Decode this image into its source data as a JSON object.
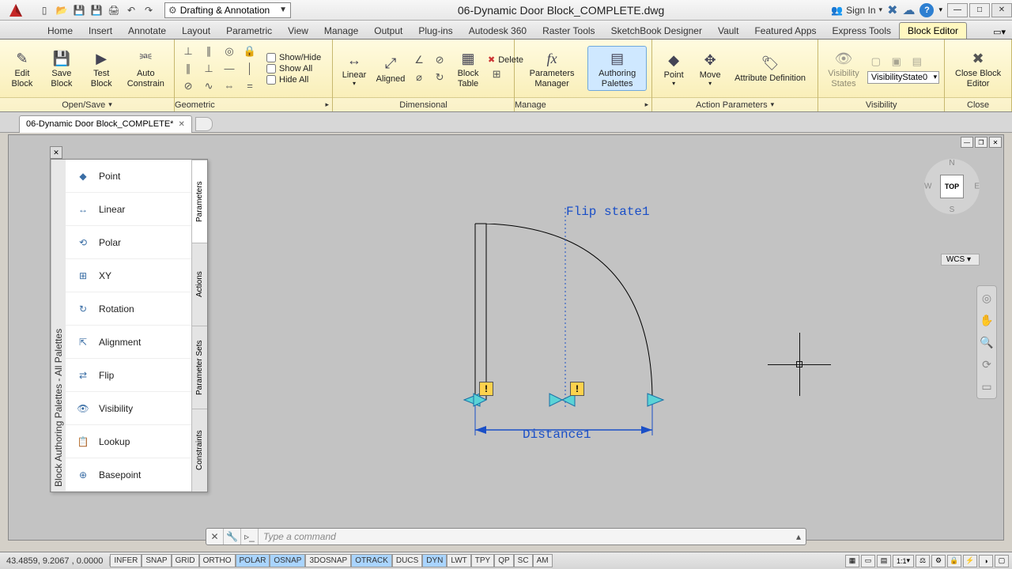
{
  "title": "06-Dynamic Door Block_COMPLETE.dwg",
  "workspace": "Drafting & Annotation",
  "signin": "Sign In",
  "tabs": [
    "Home",
    "Insert",
    "Annotate",
    "Layout",
    "Parametric",
    "View",
    "Manage",
    "Output",
    "Plug-ins",
    "Autodesk 360",
    "Raster Tools",
    "SketchBook Designer",
    "Vault",
    "Featured Apps",
    "Express Tools",
    "Block Editor"
  ],
  "active_tab": "Block Editor",
  "doc_tab": "06-Dynamic Door Block_COMPLETE*",
  "ribbon": {
    "open_save": {
      "title": "Open/Save",
      "edit": "Edit Block",
      "save": "Save Block",
      "test": "Test Block",
      "auto": "Auto Constrain"
    },
    "geometric": {
      "title": "Geometric",
      "showhide": "Show/Hide",
      "showall": "Show All",
      "hideall": "Hide All"
    },
    "dimensional": {
      "title": "Dimensional",
      "linear": "Linear",
      "aligned": "Aligned",
      "table": "Block Table",
      "delete": "Delete"
    },
    "manage": {
      "title": "Manage",
      "pm": "Parameters Manager",
      "ap": "Authoring Palettes"
    },
    "action_params": {
      "title": "Action Parameters",
      "point": "Point",
      "move": "Move",
      "attdef": "Attribute Definition"
    },
    "visibility": {
      "title": "Visibility",
      "states": "Visibility States",
      "dd": "VisibilityState0"
    },
    "close": {
      "title": "Close",
      "btn": "Close Block Editor"
    }
  },
  "palette": {
    "title": "Block Authoring Palettes - All Palettes",
    "items": [
      "Point",
      "Linear",
      "Polar",
      "XY",
      "Rotation",
      "Alignment",
      "Flip",
      "Visibility",
      "Lookup",
      "Basepoint"
    ],
    "tabs": [
      "Parameters",
      "Actions",
      "Parameter Sets",
      "Constraints"
    ]
  },
  "canvas": {
    "flip_label": "Flip state1",
    "dist_label": "Distance1",
    "vc_top": "TOP",
    "vc": {
      "n": "N",
      "s": "S",
      "e": "E",
      "w": "W"
    },
    "wcs": "WCS"
  },
  "cmdline": {
    "placeholder": "Type a command"
  },
  "status": {
    "coords": "43.4859, 9.2067 , 0.0000",
    "toggles": [
      {
        "l": "INFER",
        "on": false
      },
      {
        "l": "SNAP",
        "on": false
      },
      {
        "l": "GRID",
        "on": false
      },
      {
        "l": "ORTHO",
        "on": false
      },
      {
        "l": "POLAR",
        "on": true
      },
      {
        "l": "OSNAP",
        "on": true
      },
      {
        "l": "3DOSNAP",
        "on": false
      },
      {
        "l": "OTRACK",
        "on": true
      },
      {
        "l": "DUCS",
        "on": false
      },
      {
        "l": "DYN",
        "on": true
      },
      {
        "l": "LWT",
        "on": false
      },
      {
        "l": "TPY",
        "on": false
      },
      {
        "l": "QP",
        "on": false
      },
      {
        "l": "SC",
        "on": false
      },
      {
        "l": "AM",
        "on": false
      }
    ],
    "scale": "1:1"
  },
  "chart_data": {
    "type": "table",
    "note": "no chart in image"
  }
}
